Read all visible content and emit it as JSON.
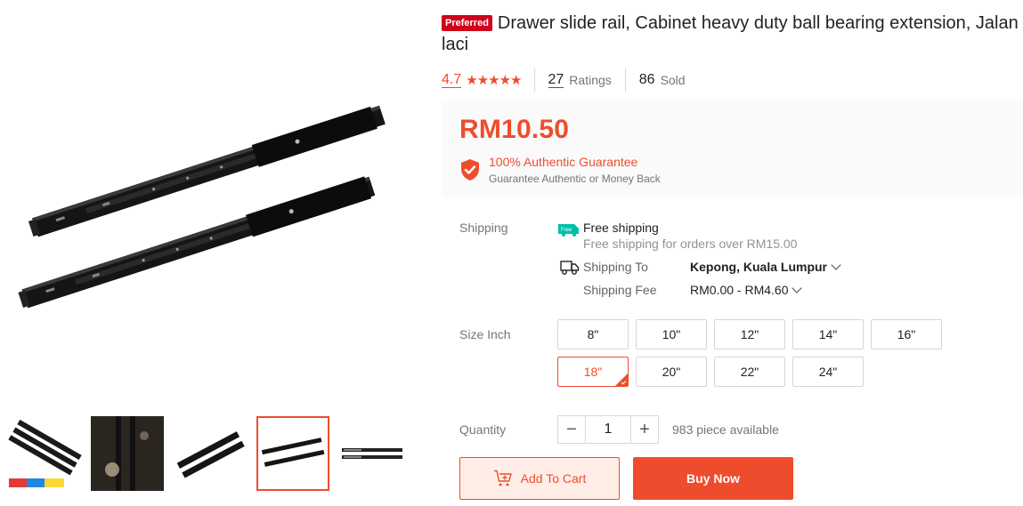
{
  "product": {
    "badge": "Preferred",
    "title": "Drawer slide rail, Cabinet heavy duty ball bearing extension, Jalan laci",
    "rating": "4.7",
    "rating_stars": 4.7,
    "ratings_count": "27",
    "ratings_label": "Ratings",
    "sold_count": "86",
    "sold_label": "Sold"
  },
  "price": {
    "value": "RM10.50",
    "guarantee_title": "100% Authentic Guarantee",
    "guarantee_sub": "Guarantee Authentic or Money Back"
  },
  "shipping": {
    "label": "Shipping",
    "free_icon_text": "Free",
    "free_title": "Free shipping",
    "free_sub": "Free shipping for orders over RM15.00",
    "to_label": "Shipping To",
    "to_value": "Kepong, Kuala Lumpur",
    "fee_label": "Shipping Fee",
    "fee_value": "RM0.00 - RM4.60"
  },
  "size": {
    "label": "Size Inch",
    "options": [
      "8\"",
      "10\"",
      "12\"",
      "14\"",
      "16\"",
      "18\"",
      "20\"",
      "22\"",
      "24\""
    ],
    "selected_index": 5
  },
  "quantity": {
    "label": "Quantity",
    "value": "1",
    "minus": "−",
    "plus": "+",
    "available": "983 piece available"
  },
  "actions": {
    "add_to_cart": "Add To Cart",
    "buy_now": "Buy Now"
  },
  "gallery": {
    "selected_thumb": 3,
    "thumb_count": 5
  },
  "colors": {
    "accent": "#ee4d2d",
    "badge": "#d0011b",
    "free_ship": "#00bfa5"
  }
}
